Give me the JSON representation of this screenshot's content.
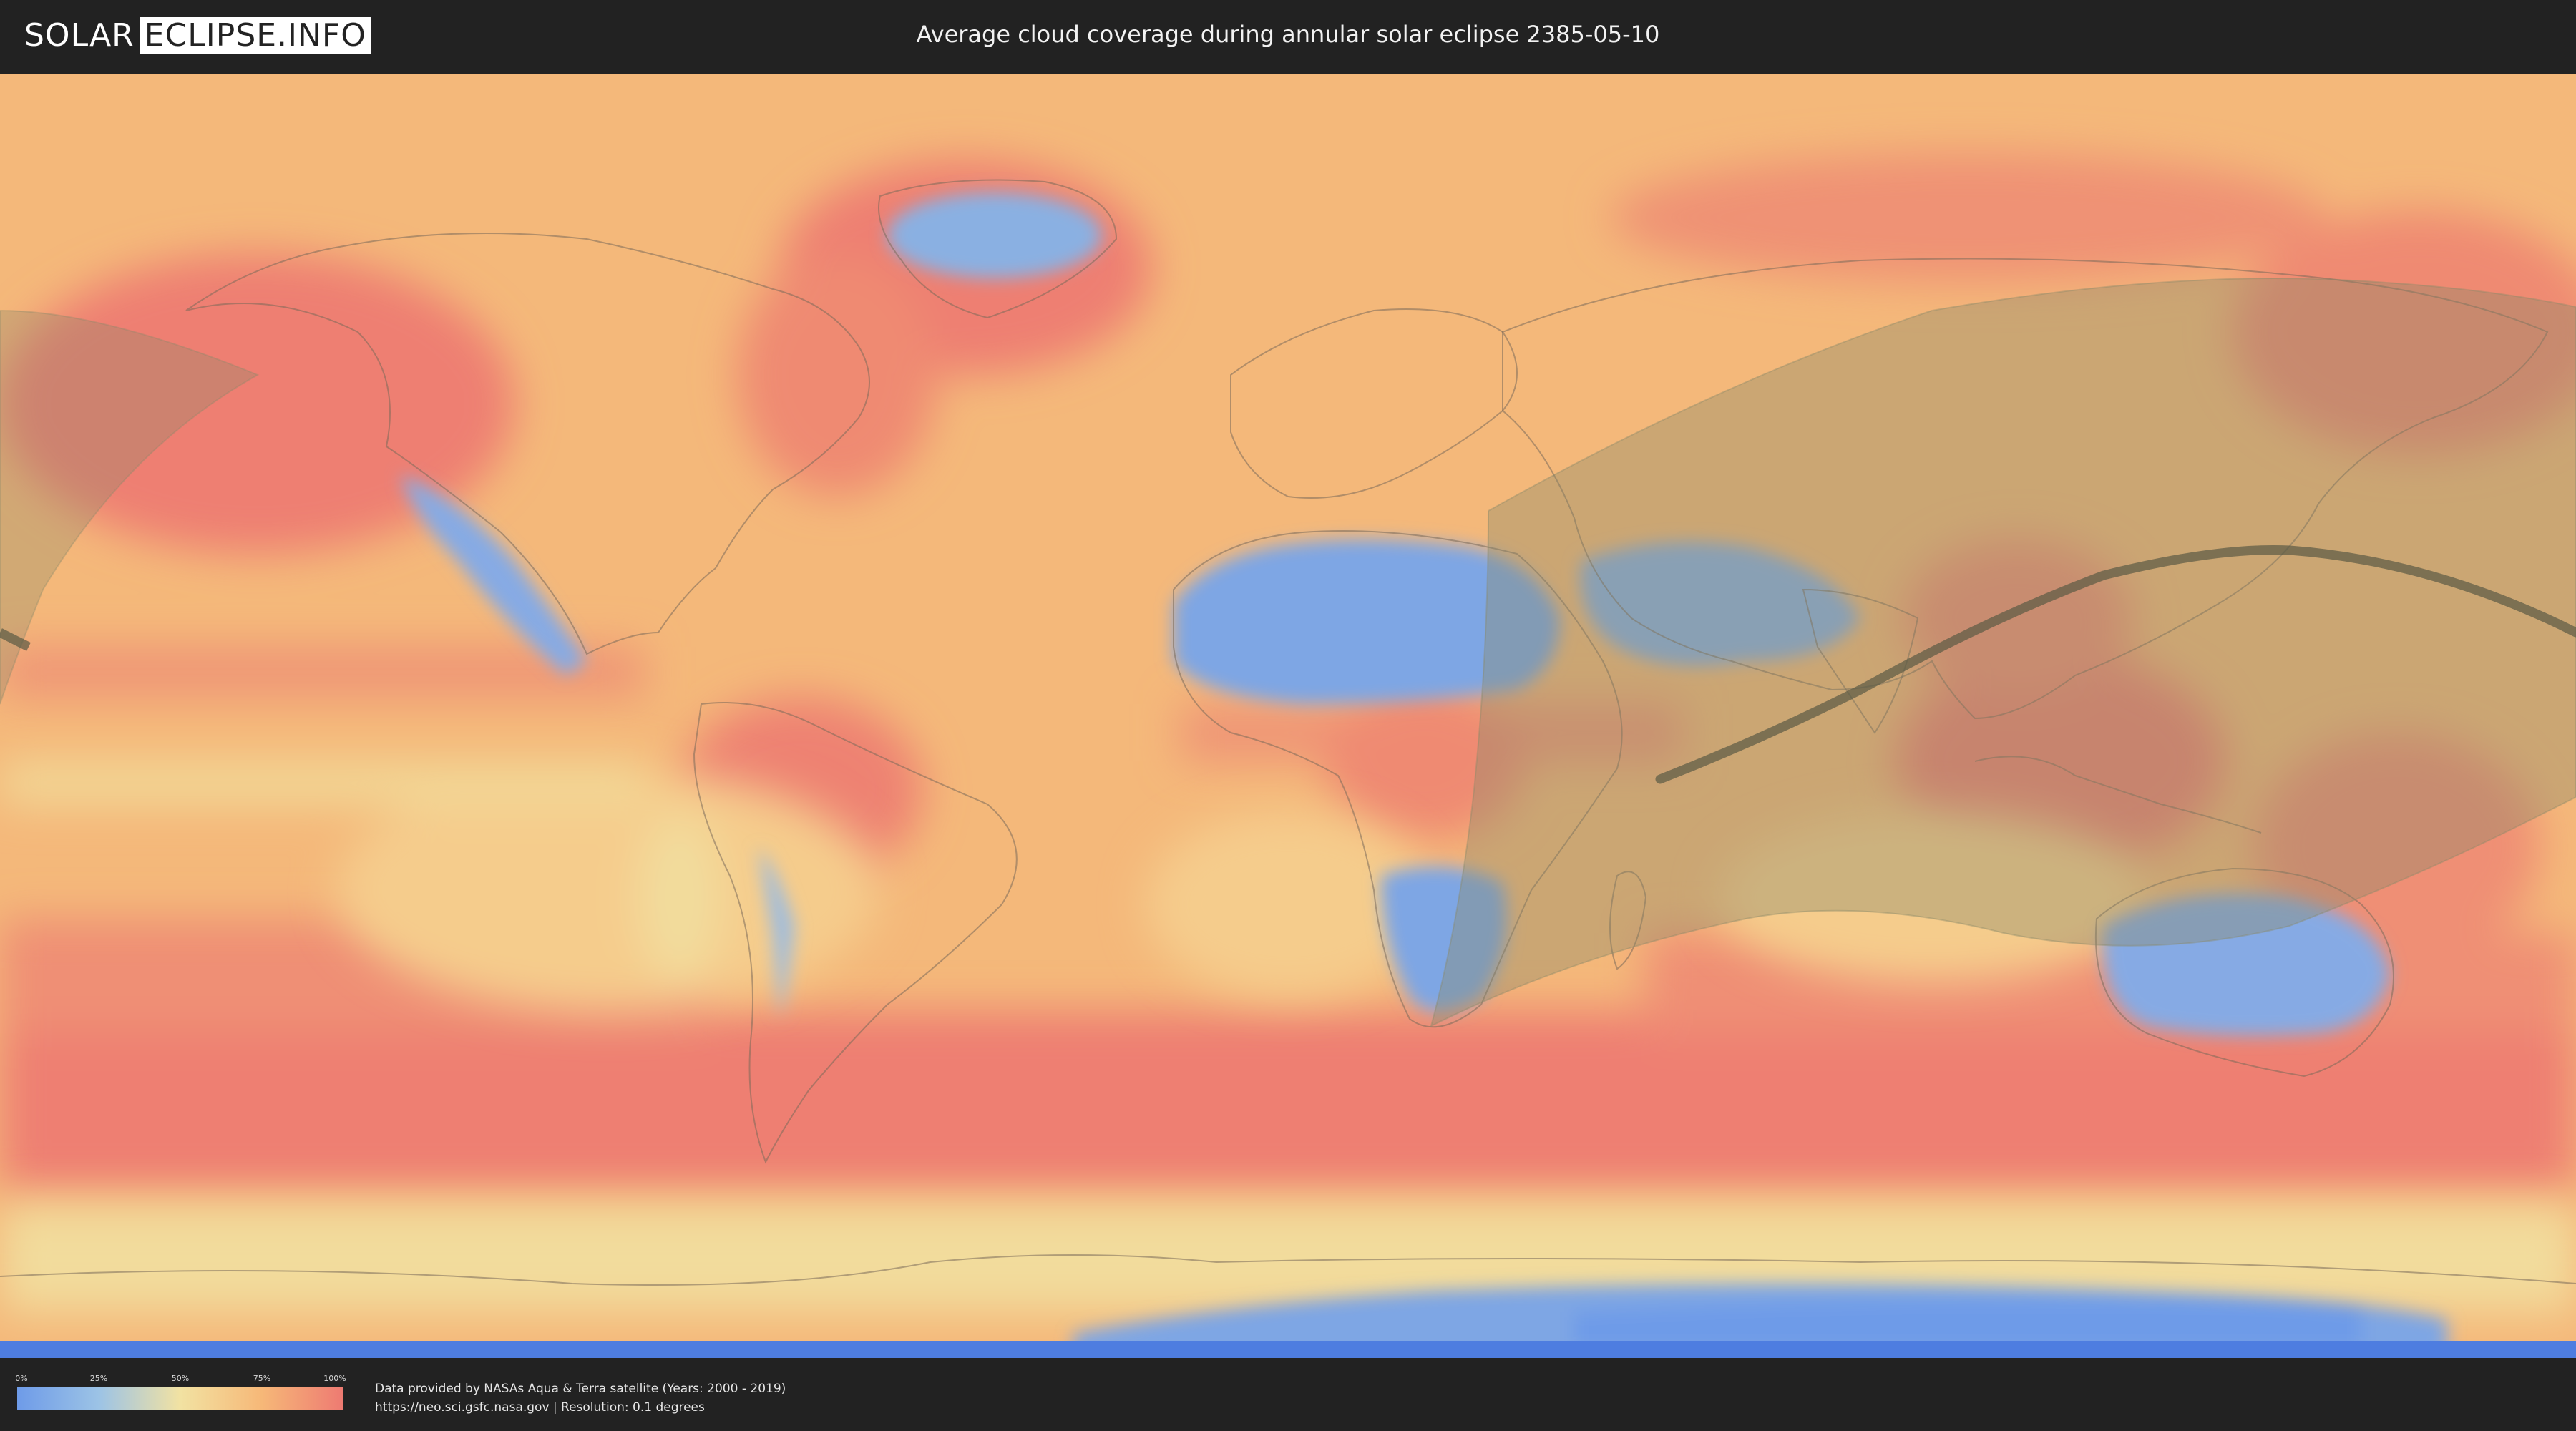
{
  "header": {
    "logo_left": "SOLAR",
    "logo_right": "ECLIPSE.INFO",
    "title": "Average cloud coverage during annular solar eclipse 2385-05-10"
  },
  "legend": {
    "ticks": [
      "0%",
      "25%",
      "50%",
      "75%",
      "100%"
    ],
    "colors": [
      "#6e9be8",
      "#9cc3e6",
      "#f2e2a2",
      "#f6b878",
      "#ee7a72"
    ]
  },
  "footer": {
    "credit_line": "Data provided by NASAs Aqua & Terra satellite (Years: 2000 - 2019)",
    "source_line": "https://neo.sci.gsfc.nasa.gov | Resolution: 0.1 degrees"
  },
  "map": {
    "projection": "equirectangular world map",
    "colors": {
      "ocean_cloudy": "#ee7f72",
      "medium": "#f4b87a",
      "light": "#f2dc9c",
      "clear": "#7ea6e4",
      "eclipse_overlay": "#8a8a6a",
      "central_path": "#5a5a44"
    }
  }
}
